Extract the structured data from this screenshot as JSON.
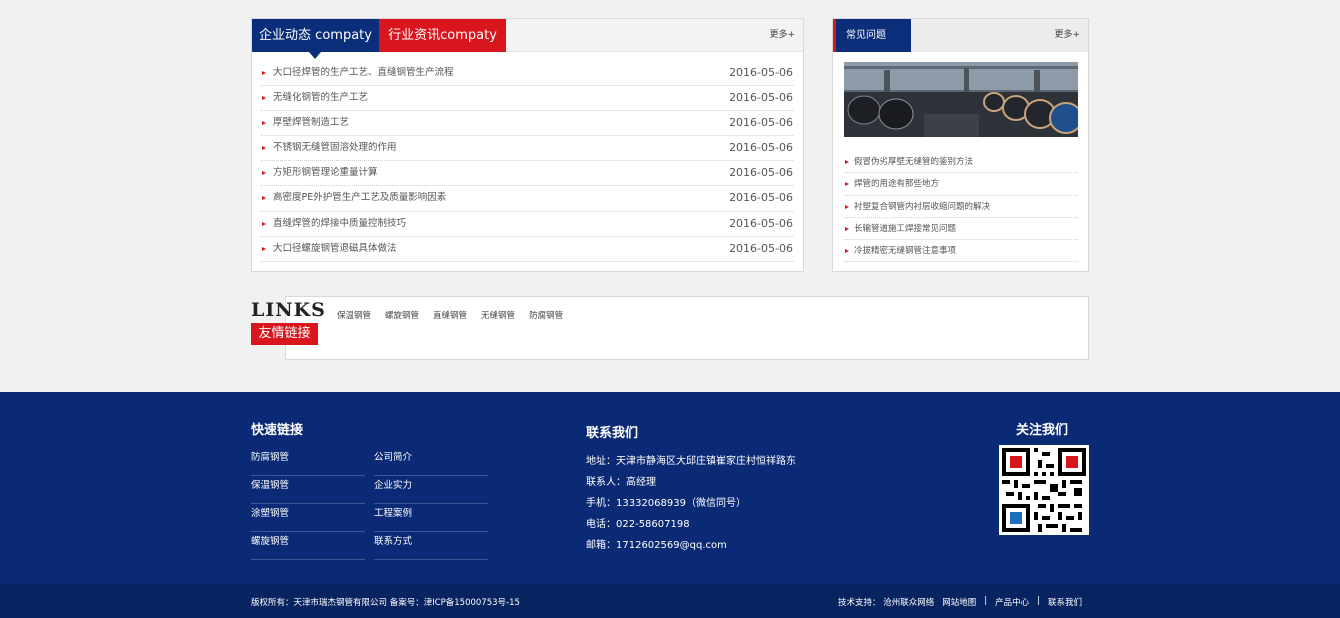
{
  "news": {
    "tabs": [
      "企业动态 compaty",
      "行业资讯compaty"
    ],
    "more": "更多+",
    "items": [
      {
        "title": "大口径焊管的生产工艺、直缝钢管生产流程",
        "date": "2016-05-06"
      },
      {
        "title": "无缝化钢管的生产工艺",
        "date": "2016-05-06"
      },
      {
        "title": "厚壁焊管制造工艺",
        "date": "2016-05-06"
      },
      {
        "title": "不锈钢无缝管固溶处理的作用",
        "date": "2016-05-06"
      },
      {
        "title": "方矩形钢管理论重量计算",
        "date": "2016-05-06"
      },
      {
        "title": "高密度PE外护管生产工艺及质量影响因素",
        "date": "2016-05-06"
      },
      {
        "title": "直缝焊管的焊接中质量控制技巧",
        "date": "2016-05-06"
      },
      {
        "title": "大口径螺旋钢管退磁具体做法",
        "date": "2016-05-06"
      }
    ]
  },
  "faq": {
    "title": "常见问题",
    "more": "更多+",
    "items": [
      "假冒伪劣厚壁无缝管的鉴别方法",
      "焊管的用途有那些地方",
      "衬塑复合钢管内衬层收缩问题的解决",
      "长输管道施工焊接常见问题",
      "冷拔精密无缝钢管注意事项"
    ]
  },
  "links": {
    "title": "LINKS",
    "subtitle": "友情链接",
    "items": [
      "保温钢管",
      "螺旋钢管",
      "直缝钢管",
      "无缝钢管",
      "防腐钢管"
    ]
  },
  "footer": {
    "quick_title": "快速链接",
    "quick_col1": [
      "防腐钢管",
      "保温钢管",
      "涂塑钢管",
      "螺旋钢管"
    ],
    "quick_col2": [
      "公司简介",
      "企业实力",
      "工程案例",
      "联系方式"
    ],
    "contact_title": "联系我们",
    "contact": [
      "地址：天津市静海区大邱庄镇崔家庄村恒祥路东",
      "联系人：高经理",
      "手机：13332068939（微信同号）",
      "电话：022-58607198",
      "邮箱：1712602569@qq.com"
    ],
    "follow_title": "关注我们"
  },
  "bottom": {
    "copyright": "版权所有：天津市瑞杰钢管有限公司    备案号：津ICP备15000753号-15",
    "support": "技术支持：  沧州联众网络",
    "nav": [
      "网站地图",
      "|",
      "产品中心",
      "|",
      "联系我们"
    ]
  },
  "colors": {
    "brand_blue": "#0b2e7a",
    "brand_red": "#d9161d"
  }
}
